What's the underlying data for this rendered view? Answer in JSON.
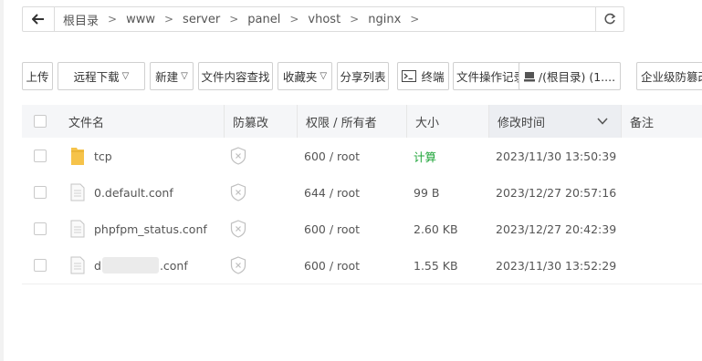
{
  "breadcrumb": {
    "segments": [
      "根目录",
      "www",
      "server",
      "panel",
      "vhost",
      "nginx"
    ],
    "separator": ">"
  },
  "toolbar": {
    "upload": "上传",
    "remote_download": "远程下载",
    "new": "新建",
    "content_search": "文件内容查找",
    "favorites": "收藏夹",
    "share_list": "分享列表",
    "terminal": "终端",
    "operation_log": "文件操作记录",
    "disk": "/(根目录) (1....",
    "enterprise_tamper": "企业级防篡改"
  },
  "table": {
    "headers": {
      "name": "文件名",
      "tamper": "防篡改",
      "perm_owner": "权限 / 所有者",
      "size": "大小",
      "modified": "修改时间",
      "note": "备注"
    },
    "rows": [
      {
        "type": "folder",
        "name": "tcp",
        "perm": "600 / root",
        "size": "计算",
        "modified": "2023/11/30 13:50:39"
      },
      {
        "type": "file",
        "name": "0.default.conf",
        "perm": "644 / root",
        "size": "99 B",
        "modified": "2023/12/27 20:57:16"
      },
      {
        "type": "file",
        "name": "phpfpm_status.conf",
        "perm": "600 / root",
        "size": "2.60 KB",
        "modified": "2023/12/27 20:42:39"
      },
      {
        "type": "file",
        "name_prefix": "d",
        "name_suffix": ".conf",
        "perm": "600 / root",
        "size": "1.55 KB",
        "modified": "2023/11/30 13:52:29"
      }
    ]
  },
  "colors": {
    "accent_green": "#20a53a",
    "folder": "#f6c34a",
    "header_bg": "#f5f6f8"
  }
}
